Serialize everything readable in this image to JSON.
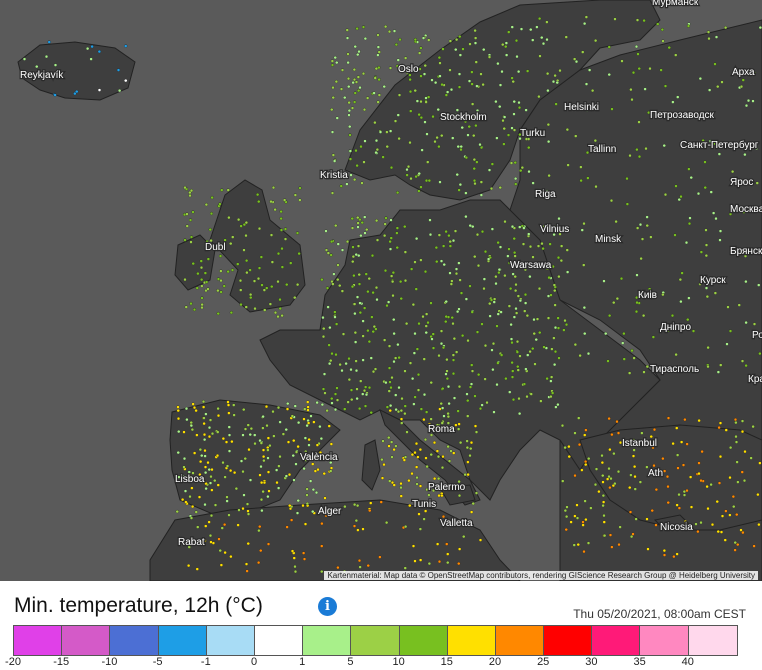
{
  "map": {
    "cities": [
      "Reykjavík",
      "Мурманск",
      "Арха",
      "Петрозаводск",
      "Санкт-Петербург",
      "Ярос",
      "Москва",
      "Брянск",
      "Курск",
      "Киів",
      "Росто",
      "Красно",
      "Дніпро",
      "Тирасполь",
      "Vilnius",
      "Minsk",
      "Warsawa",
      "Kristia",
      "Dubl",
      "Istanbul",
      "Ath",
      "Nicosia",
      "Alger",
      "Tunis",
      "Valletta",
      "Rabat",
      "Lisboa",
      "València",
      "Palermo",
      "Roma",
      "Oslo",
      "Turku",
      "Tallinn",
      "Riga",
      "Stockholm",
      "Helsinki"
    ],
    "attribution": "Kartenmaterial: Map data © OpenStreetMap contributors, rendering GIScience Research Group @ Heidelberg University"
  },
  "legend": {
    "title": "Min. temperature, 12h (°C)",
    "info_icon": "info-icon",
    "timestamp": "Thu 05/20/2021, 08:00am CEST",
    "colors": [
      "#e040e8",
      "#d45ac8",
      "#4c6fd4",
      "#1e9ee6",
      "#a8dcf5",
      "#ffffff",
      "#a8f08a",
      "#9cd046",
      "#78c020",
      "#ffe000",
      "#ff8800",
      "#ff0000",
      "#ff1a78",
      "#ff88c0",
      "#ffd8ec"
    ],
    "ticks": [
      "-20",
      "-15",
      "-10",
      "-5",
      "-1",
      "0",
      "1",
      "5",
      "10",
      "15",
      "20",
      "25",
      "30",
      "35",
      "40"
    ]
  }
}
